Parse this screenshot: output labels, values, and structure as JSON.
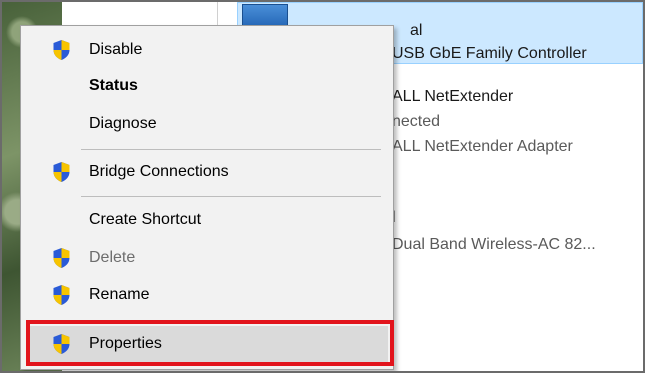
{
  "background_window": {
    "row1": {
      "line1": "al",
      "line2": "USB GbE Family Controller"
    },
    "row2": {
      "line1": "ALL NetExtender",
      "line2": "nected",
      "line3": "ALL NetExtender Adapter"
    },
    "row3": {
      "line1": "l",
      "line2": "Dual Band Wireless-AC 82..."
    }
  },
  "context_menu": {
    "items": [
      {
        "label": "Disable",
        "icon": "uac-shield-icon",
        "bold": false,
        "disabled": false
      },
      {
        "label": "Status",
        "icon": null,
        "bold": true,
        "disabled": false
      },
      {
        "label": "Diagnose",
        "icon": null,
        "bold": false,
        "disabled": false
      },
      {
        "label": "Bridge Connections",
        "icon": "uac-shield-icon",
        "bold": false,
        "disabled": false
      },
      {
        "label": "Create Shortcut",
        "icon": null,
        "bold": false,
        "disabled": false
      },
      {
        "label": "Delete",
        "icon": "uac-shield-icon",
        "bold": false,
        "disabled": true
      },
      {
        "label": "Rename",
        "icon": "uac-shield-icon",
        "bold": false,
        "disabled": false
      },
      {
        "label": "Properties",
        "icon": "uac-shield-icon",
        "bold": false,
        "disabled": false,
        "highlighted": true
      }
    ]
  },
  "colors": {
    "highlight_box": "#e2141c",
    "selection_bg": "#cce8ff",
    "menu_bg": "#f2f2f2",
    "shield_blue": "#2a5bd7",
    "shield_yellow": "#f7c400"
  }
}
